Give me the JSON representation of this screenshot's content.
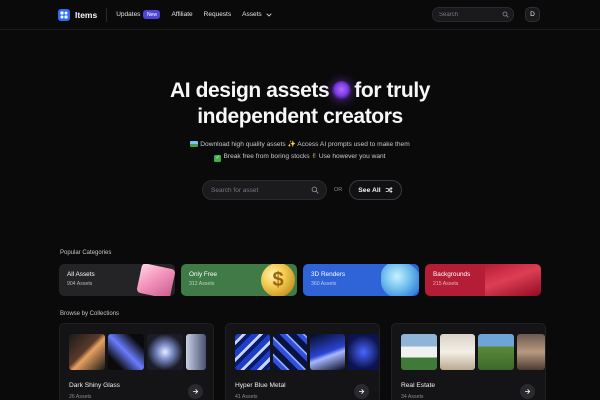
{
  "nav": {
    "logo_text": "Items",
    "links": [
      {
        "label": "Updates",
        "badge": "New"
      },
      {
        "label": "Affiliate"
      },
      {
        "label": "Requests"
      },
      {
        "label": "Assets"
      }
    ],
    "search_placeholder": "Search",
    "avatar_initial": "D"
  },
  "hero": {
    "title_line1_a": "AI design assets",
    "title_line1_b": "for truly",
    "title_line2": "independent creators",
    "sub_line1_a": "Download high quality assets",
    "sub_line1_b": "Access AI prompts used to make them",
    "sub_line2_a": "Break free from boring stocks",
    "sub_line2_b": "Use however you want",
    "search_placeholder": "Search for asset",
    "or_label": "OR",
    "see_all_label": "See All"
  },
  "categories": {
    "heading": "Popular Categories",
    "items": [
      {
        "title": "All Assets",
        "count": "904 Assets",
        "color": "#242427"
      },
      {
        "title": "Only Free",
        "count": "312 Assets",
        "color": "#3f7a47"
      },
      {
        "title": "3D Renders",
        "count": "360 Assets",
        "color": "#2f63d8"
      },
      {
        "title": "Backgrounds",
        "count": "215 Assets",
        "color": "#b51c35"
      }
    ]
  },
  "collections": {
    "heading": "Browse by Collections",
    "items": [
      {
        "title": "Dark Shiny Glass",
        "count": "26 Assets"
      },
      {
        "title": "Hyper Blue Metal",
        "count": "41 Assets"
      },
      {
        "title": "Real Estate",
        "count": "34 Assets"
      }
    ]
  }
}
